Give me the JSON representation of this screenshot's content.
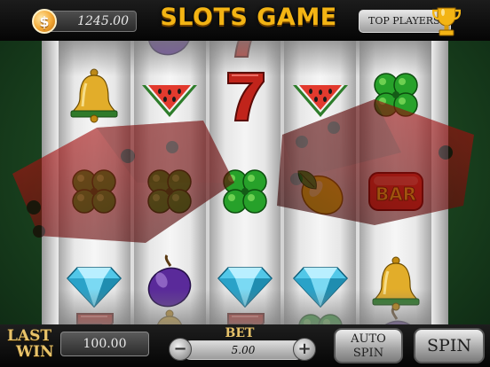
{
  "header": {
    "currency_symbol": "$",
    "balance": "1245.00",
    "title": "SLOTS GAME",
    "top_players_label": "TOP PLAYERS"
  },
  "reels": [
    [
      "bell",
      "clover",
      "diamond"
    ],
    [
      "watermelon",
      "clover",
      "plum"
    ],
    [
      "seven",
      "clover",
      "diamond"
    ],
    [
      "watermelon",
      "lemon",
      "diamond"
    ],
    [
      "clover",
      "bar",
      "bell"
    ]
  ],
  "bar_symbol_text": "BAR",
  "footer": {
    "last_win_line1": "LAST",
    "last_win_line2": "WIN",
    "last_win_value": "100.00",
    "bet_label": "BET",
    "bet_value": "5.00",
    "bet_minus": "−",
    "bet_plus": "+",
    "auto_spin_line1": "AUTO",
    "auto_spin_line2": "SPIN",
    "spin_label": "SPIN"
  },
  "colors": {
    "title_gold": "#f3b414",
    "felt_green": "#2f6b33",
    "dice_red": "#8a0a0a"
  }
}
